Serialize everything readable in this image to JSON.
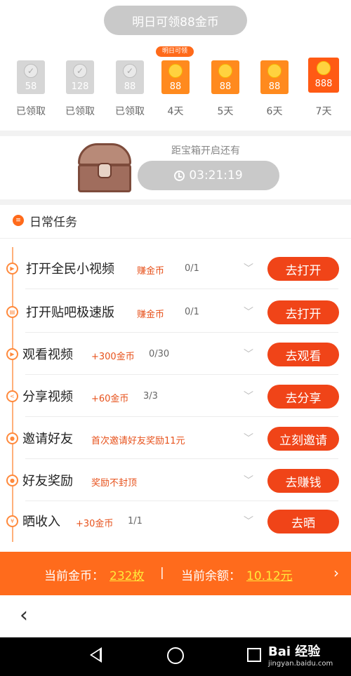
{
  "header": {
    "pill_text": "明日可领88金币"
  },
  "checkin": {
    "days": [
      {
        "amount": "58",
        "label": "已领取",
        "state": "claimed",
        "tag": ""
      },
      {
        "amount": "128",
        "label": "已领取",
        "state": "claimed",
        "tag": ""
      },
      {
        "amount": "88",
        "label": "已领取",
        "state": "claimed",
        "tag": ""
      },
      {
        "amount": "88",
        "label": "4天",
        "state": "pending",
        "tag": "明日可领"
      },
      {
        "amount": "88",
        "label": "5天",
        "state": "pending",
        "tag": ""
      },
      {
        "amount": "88",
        "label": "6天",
        "state": "pending",
        "tag": ""
      },
      {
        "amount": "888",
        "label": "7天",
        "state": "big",
        "tag": ""
      }
    ]
  },
  "treasure": {
    "countdown_label": "距宝箱开启还有",
    "time": "03:21:19"
  },
  "tasks_section": {
    "title": "日常任务"
  },
  "tasks": [
    {
      "name": "打开全民小视频",
      "reward": "赚金币",
      "progress": "0/1",
      "button": "去打开",
      "icon": "video-icon"
    },
    {
      "name": "打开贴吧极速版",
      "reward": "赚金币",
      "progress": "0/1",
      "button": "去打开",
      "icon": "app-icon"
    },
    {
      "name": "观看视频",
      "reward": "+300金币",
      "progress": "0/30",
      "button": "去观看",
      "icon": "play-icon"
    },
    {
      "name": "分享视频",
      "reward": "+60金币",
      "progress": "3/3",
      "button": "去分享",
      "icon": "share-icon"
    },
    {
      "name": "邀请好友",
      "reward": "首次邀请好友奖励11元",
      "progress": "",
      "button": "立刻邀请",
      "icon": "user-icon"
    },
    {
      "name": "好友奖励",
      "reward": "奖励不封顶",
      "progress": "",
      "button": "去赚钱",
      "icon": "user-icon"
    },
    {
      "name": "晒收入",
      "reward": "+30金币",
      "progress": "1/1",
      "button": "去晒",
      "icon": "yen-icon"
    }
  ],
  "balance": {
    "coin_label": "当前金币：",
    "coin_value": "232枚",
    "separator": "|",
    "cash_label": "当前余额：",
    "cash_value": "10.12元",
    "arrow": "›"
  },
  "nav": {
    "back": "‹",
    "watermark": "Bai 经验",
    "watermark_sub": "jingyan.baidu.com"
  },
  "colors": {
    "accent": "#f04418",
    "orange_bar": "#ff6b1c",
    "highlight": "#ffea3a",
    "grey_pill": "#c9c9c9"
  }
}
